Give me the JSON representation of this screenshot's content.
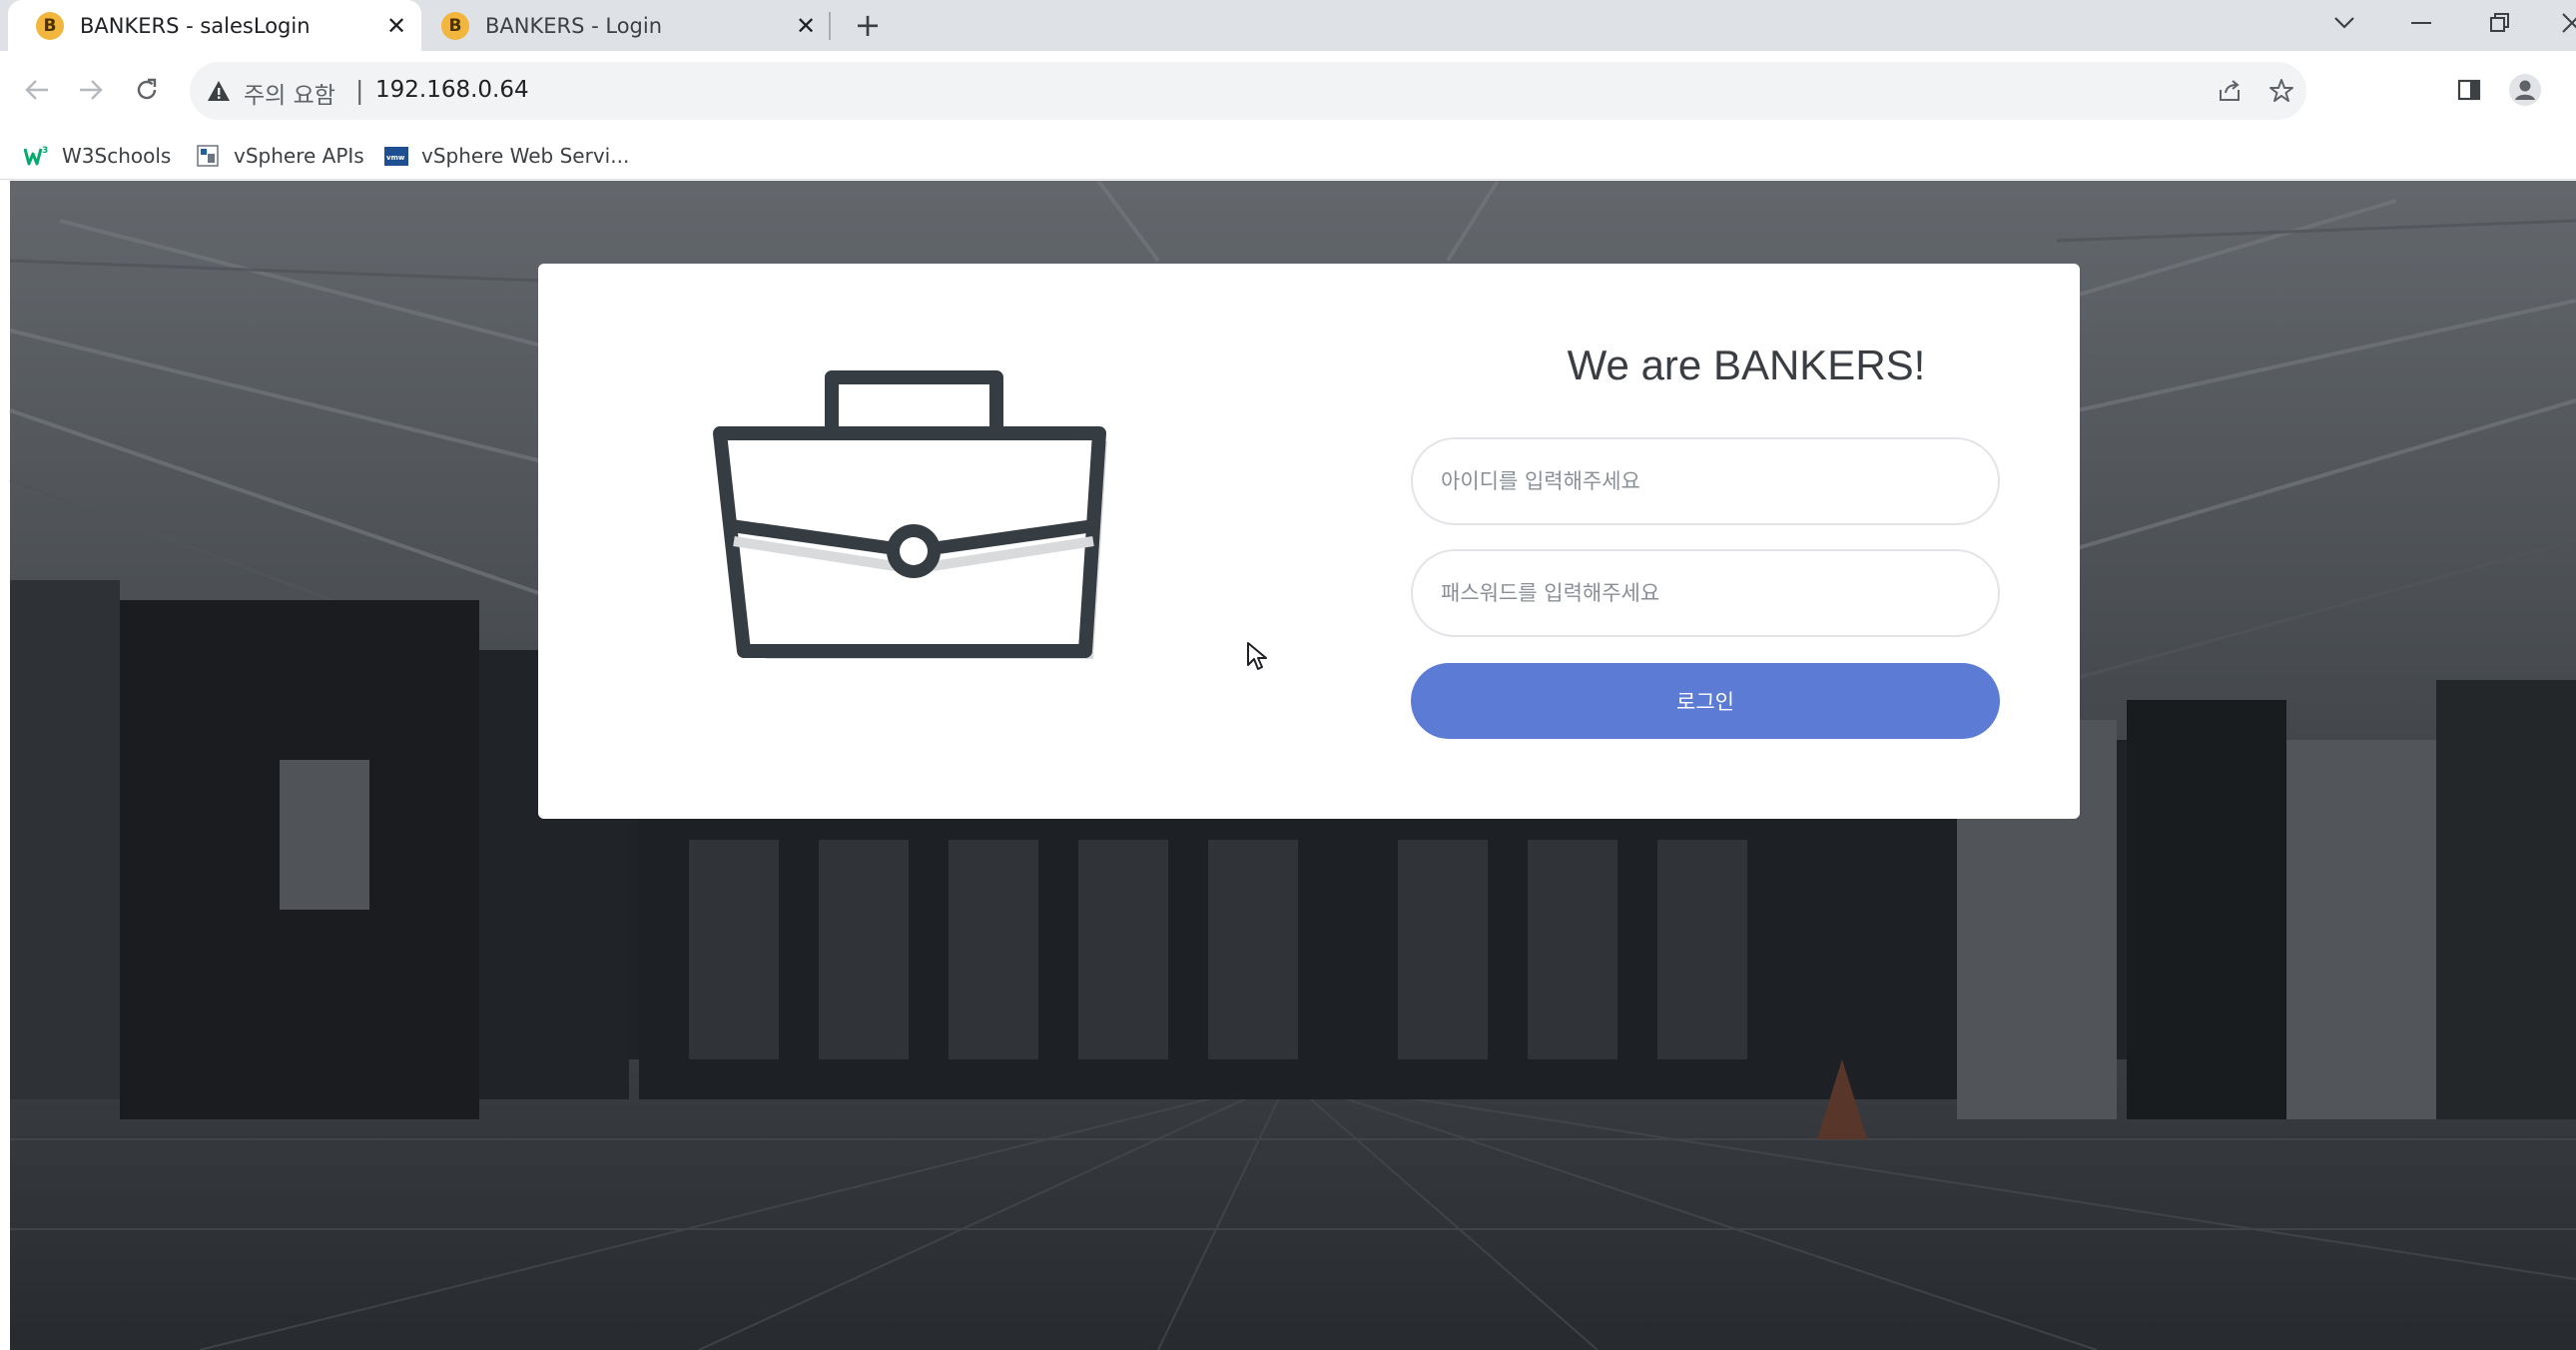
{
  "browser": {
    "tabs": [
      {
        "favicon_letter": "B",
        "title": "BANKERS - salesLogin",
        "close": "✕",
        "active": true
      },
      {
        "favicon_letter": "B",
        "title": "BANKERS - Login",
        "close": "✕",
        "active": false
      }
    ],
    "new_tab": "+",
    "window_controls": {
      "tab_search": "⌄",
      "minimize": "─",
      "restore": "❐",
      "close": "✕"
    },
    "nav": {
      "back": "←",
      "forward": "→",
      "reload": "↻"
    },
    "address": {
      "security_warning": "주의 요함",
      "separator": "|",
      "url": "192.168.0.64"
    },
    "bookmarks": [
      {
        "label": "W3Schools",
        "icon": "w3schools-icon"
      },
      {
        "label": "vSphere APIs",
        "icon": "vsphere-icon"
      },
      {
        "label": "vSphere Web Servi...",
        "icon": "vmware-icon"
      }
    ]
  },
  "page": {
    "title": "We are BANKERS!",
    "id_placeholder": "아이디를 입력해주세요",
    "password_placeholder": "패스워드를 입력해주세요",
    "login_button": "로그인",
    "colors": {
      "button": "#5b7bd5",
      "briefcase_stroke": "#363d42",
      "overlay": "#23262b"
    }
  }
}
